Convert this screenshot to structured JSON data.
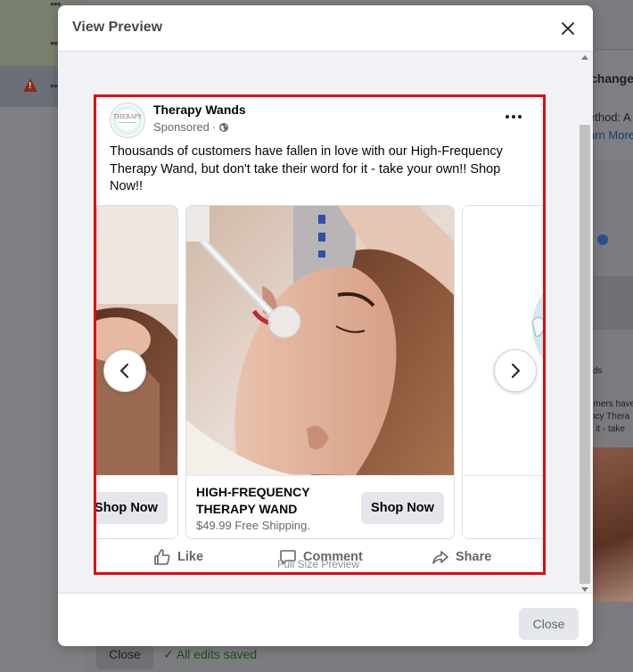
{
  "background": {
    "right_text_1": "changes",
    "right_text_2": "ethod: A",
    "right_link": "arn More",
    "right_text_3": "ds",
    "right_text_4": "omers have",
    "right_text_5": "ncy Thera",
    "right_text_6": "r it - take",
    "footer_close": "Close",
    "saved_status": "All edits saved"
  },
  "modal": {
    "title": "View Preview",
    "full_size_label": "Full Size Preview",
    "close_button": "Close"
  },
  "ad": {
    "page_name": "Therapy Wands",
    "sponsored": "Sponsored",
    "separator": "·",
    "logo_text": "THERAPY",
    "primary_text": "Thousands of customers have fallen in love with our High-Frequency Therapy Wand, but don't take their word for it - take your own!! Shop Now!!",
    "cards": [
      {
        "cta": "Shop Now"
      },
      {
        "headline": "HIGH-FREQUENCY THERAPY WAND",
        "description": "$49.99 Free Shipping.",
        "cta": "Shop Now"
      },
      {
        "cta": ""
      }
    ],
    "actions": {
      "like": "Like",
      "comment": "Comment",
      "share": "Share"
    }
  },
  "colors": {
    "highlight_border": "#e00b0b",
    "button_bg": "#e4e6eb",
    "secondary_text": "#65676b"
  },
  "icons": {
    "close": "close-icon",
    "globe": "globe-icon",
    "more": "more-horizontal-icon",
    "prev": "chevron-left-icon",
    "next": "chevron-right-icon",
    "like": "thumbs-up-icon",
    "comment": "comment-icon",
    "share": "share-icon"
  }
}
